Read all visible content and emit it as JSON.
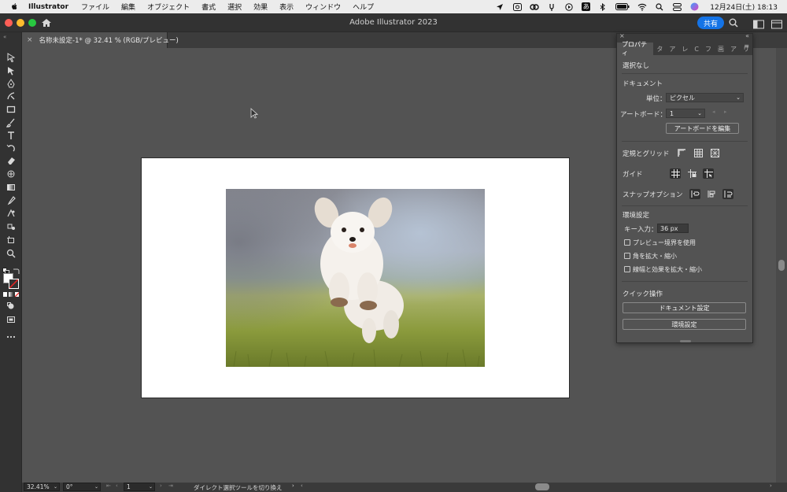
{
  "menubar": {
    "app_name": "Illustrator",
    "items": [
      "ファイル",
      "編集",
      "オブジェクト",
      "書式",
      "選択",
      "効果",
      "表示",
      "ウィンドウ",
      "ヘルプ"
    ],
    "ime_label": "あ",
    "datetime": "12月24日(土)  18:13"
  },
  "titlebar": {
    "title": "Adobe Illustrator 2023",
    "share_label": "共有"
  },
  "document_tab": {
    "title": "名称未設定-1* @ 32.41 % (RGB/プレビュー)",
    "close": "×"
  },
  "panel": {
    "tabs": [
      "プロパティ",
      "タ",
      "ア",
      "レ",
      "C",
      "フ",
      "画",
      "ア",
      "リ"
    ],
    "selection_status": "選択なし",
    "document_heading": "ドキュメント",
    "units_label": "単位：",
    "units_value": "ピクセル",
    "artboard_label": "アートボード：",
    "artboard_value": "1",
    "edit_artboards_button": "アートボードを編集",
    "rulers_grids_label": "定規とグリッド",
    "guides_label": "ガイド",
    "snap_options_label": "スナップオプション",
    "preferences_heading": "環境設定",
    "key_increment_label": "キー入力：",
    "key_increment_value": "36 px",
    "checkbox_preview_bounds": "プレビュー境界を使用",
    "checkbox_scale_corners": "角を拡大・縮小",
    "checkbox_scale_strokes": "線幅と効果を拡大・縮小",
    "quick_actions_heading": "クイック操作",
    "document_setup_button": "ドキュメント設定",
    "preferences_button": "環境設定"
  },
  "statusbar": {
    "zoom": "32.41%",
    "rotation": "0°",
    "artboard_number": "1",
    "tool_hint": "ダイレクト選択ツールを切り換え"
  },
  "colors": {
    "accent": "#1473e6",
    "canvas_bg": "#535353",
    "chrome_dark": "#323232"
  }
}
